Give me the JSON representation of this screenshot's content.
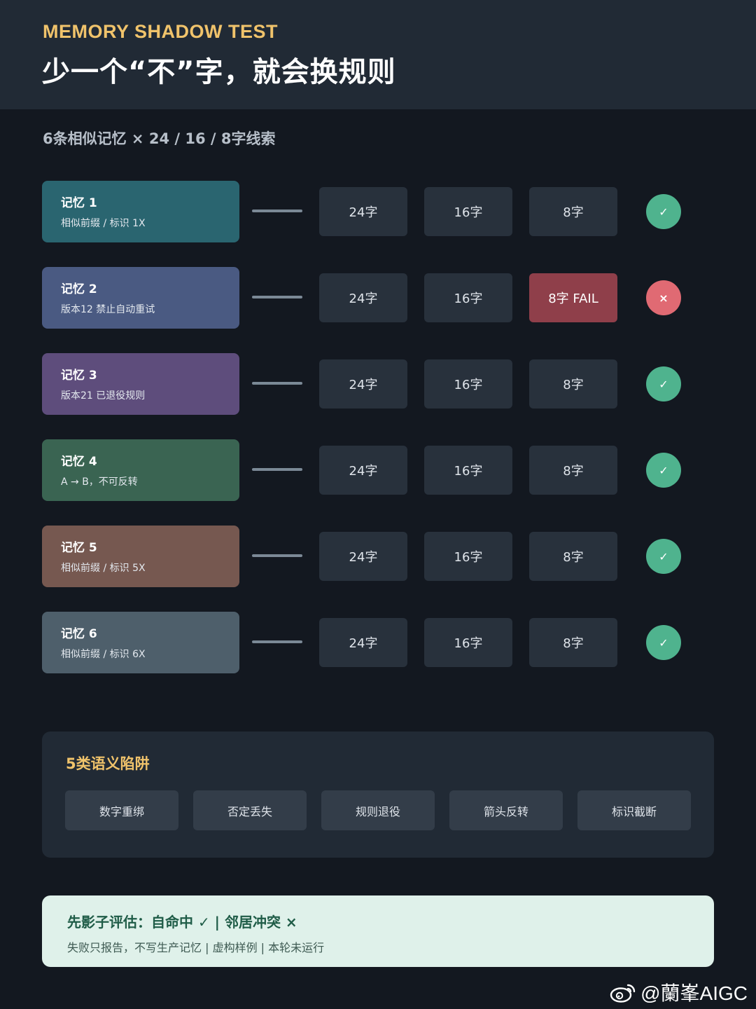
{
  "header": {
    "eyebrow": "MEMORY SHADOW TEST",
    "title": "少一个“不”字，就会换规则"
  },
  "subtitle": "6条相似记忆 × 24 / 16 / 8字线索",
  "memories": [
    {
      "title": "记忆 1",
      "desc": "相似前缀 / 标识 1X",
      "color": "#2a6570",
      "cues": [
        "24字",
        "16字",
        "8字"
      ],
      "fail_index": -1,
      "status": "✓"
    },
    {
      "title": "记忆 2",
      "desc": "版本12 禁止自动重试",
      "color": "#4a5a82",
      "cues": [
        "24字",
        "16字",
        "8字 FAIL"
      ],
      "fail_index": 2,
      "status": "×"
    },
    {
      "title": "记忆 3",
      "desc": "版本21 已退役规则",
      "color": "#5e4d7c",
      "cues": [
        "24字",
        "16字",
        "8字"
      ],
      "fail_index": -1,
      "status": "✓"
    },
    {
      "title": "记忆 4",
      "desc": "A → B，不可反转",
      "color": "#3a6452",
      "cues": [
        "24字",
        "16字",
        "8字"
      ],
      "fail_index": -1,
      "status": "✓"
    },
    {
      "title": "记忆 5",
      "desc": "相似前缀 / 标识 5X",
      "color": "#765850",
      "cues": [
        "24字",
        "16字",
        "8字"
      ],
      "fail_index": -1,
      "status": "✓"
    },
    {
      "title": "记忆 6",
      "desc": "相似前缀 / 标识 6X",
      "color": "#4e5f6b",
      "cues": [
        "24字",
        "16字",
        "8字"
      ],
      "fail_index": -1,
      "status": "✓"
    }
  ],
  "traps": {
    "title": "5类语义陷阱",
    "items": [
      "数字重绑",
      "否定丢失",
      "规则退役",
      "箭头反转",
      "标识截断"
    ]
  },
  "footer": {
    "line1": "先影子评估：自命中 ✓ | 邻居冲突 ×",
    "line2": "失败只报告，不写生产记忆 | 虚构样例 | 本轮未运行"
  },
  "watermark": {
    "text": "@蘭峯AIGC",
    "icon": "weibo-icon"
  },
  "colors": {
    "ok": "#4fb38e",
    "fail": "#e06a73",
    "accent": "#f0c36b"
  }
}
